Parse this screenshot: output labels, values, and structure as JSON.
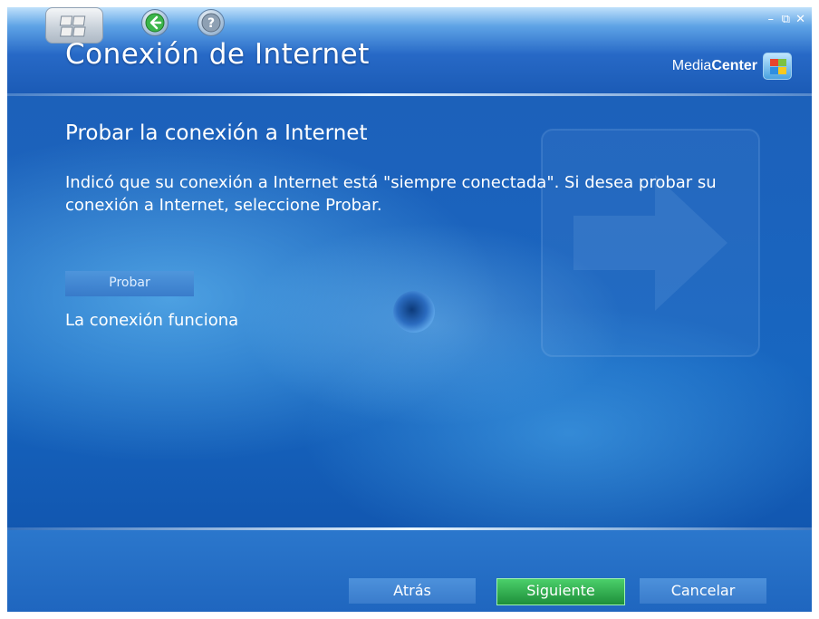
{
  "window": {
    "title": "Conexión de Internet",
    "controls": [
      "–",
      "⧉",
      "✕"
    ]
  },
  "branding": {
    "media": "Media",
    "center": "Center"
  },
  "nav": {
    "start": "start-button",
    "back": "back-arrow-icon",
    "help": "help-question-icon"
  },
  "content": {
    "heading": "Probar la conexión a Internet",
    "description": "Indicó que su conexión a Internet está \"siempre conectada\". Si desea probar su conexión a Internet, seleccione Probar.",
    "test_button": "Probar",
    "status": "La conexión funciona"
  },
  "footer": {
    "back_label": "Atrás",
    "next_label": "Siguiente",
    "cancel_label": "Cancelar"
  },
  "colors": {
    "accent": "#1b63bd",
    "primary_button": "#2fae4f"
  }
}
